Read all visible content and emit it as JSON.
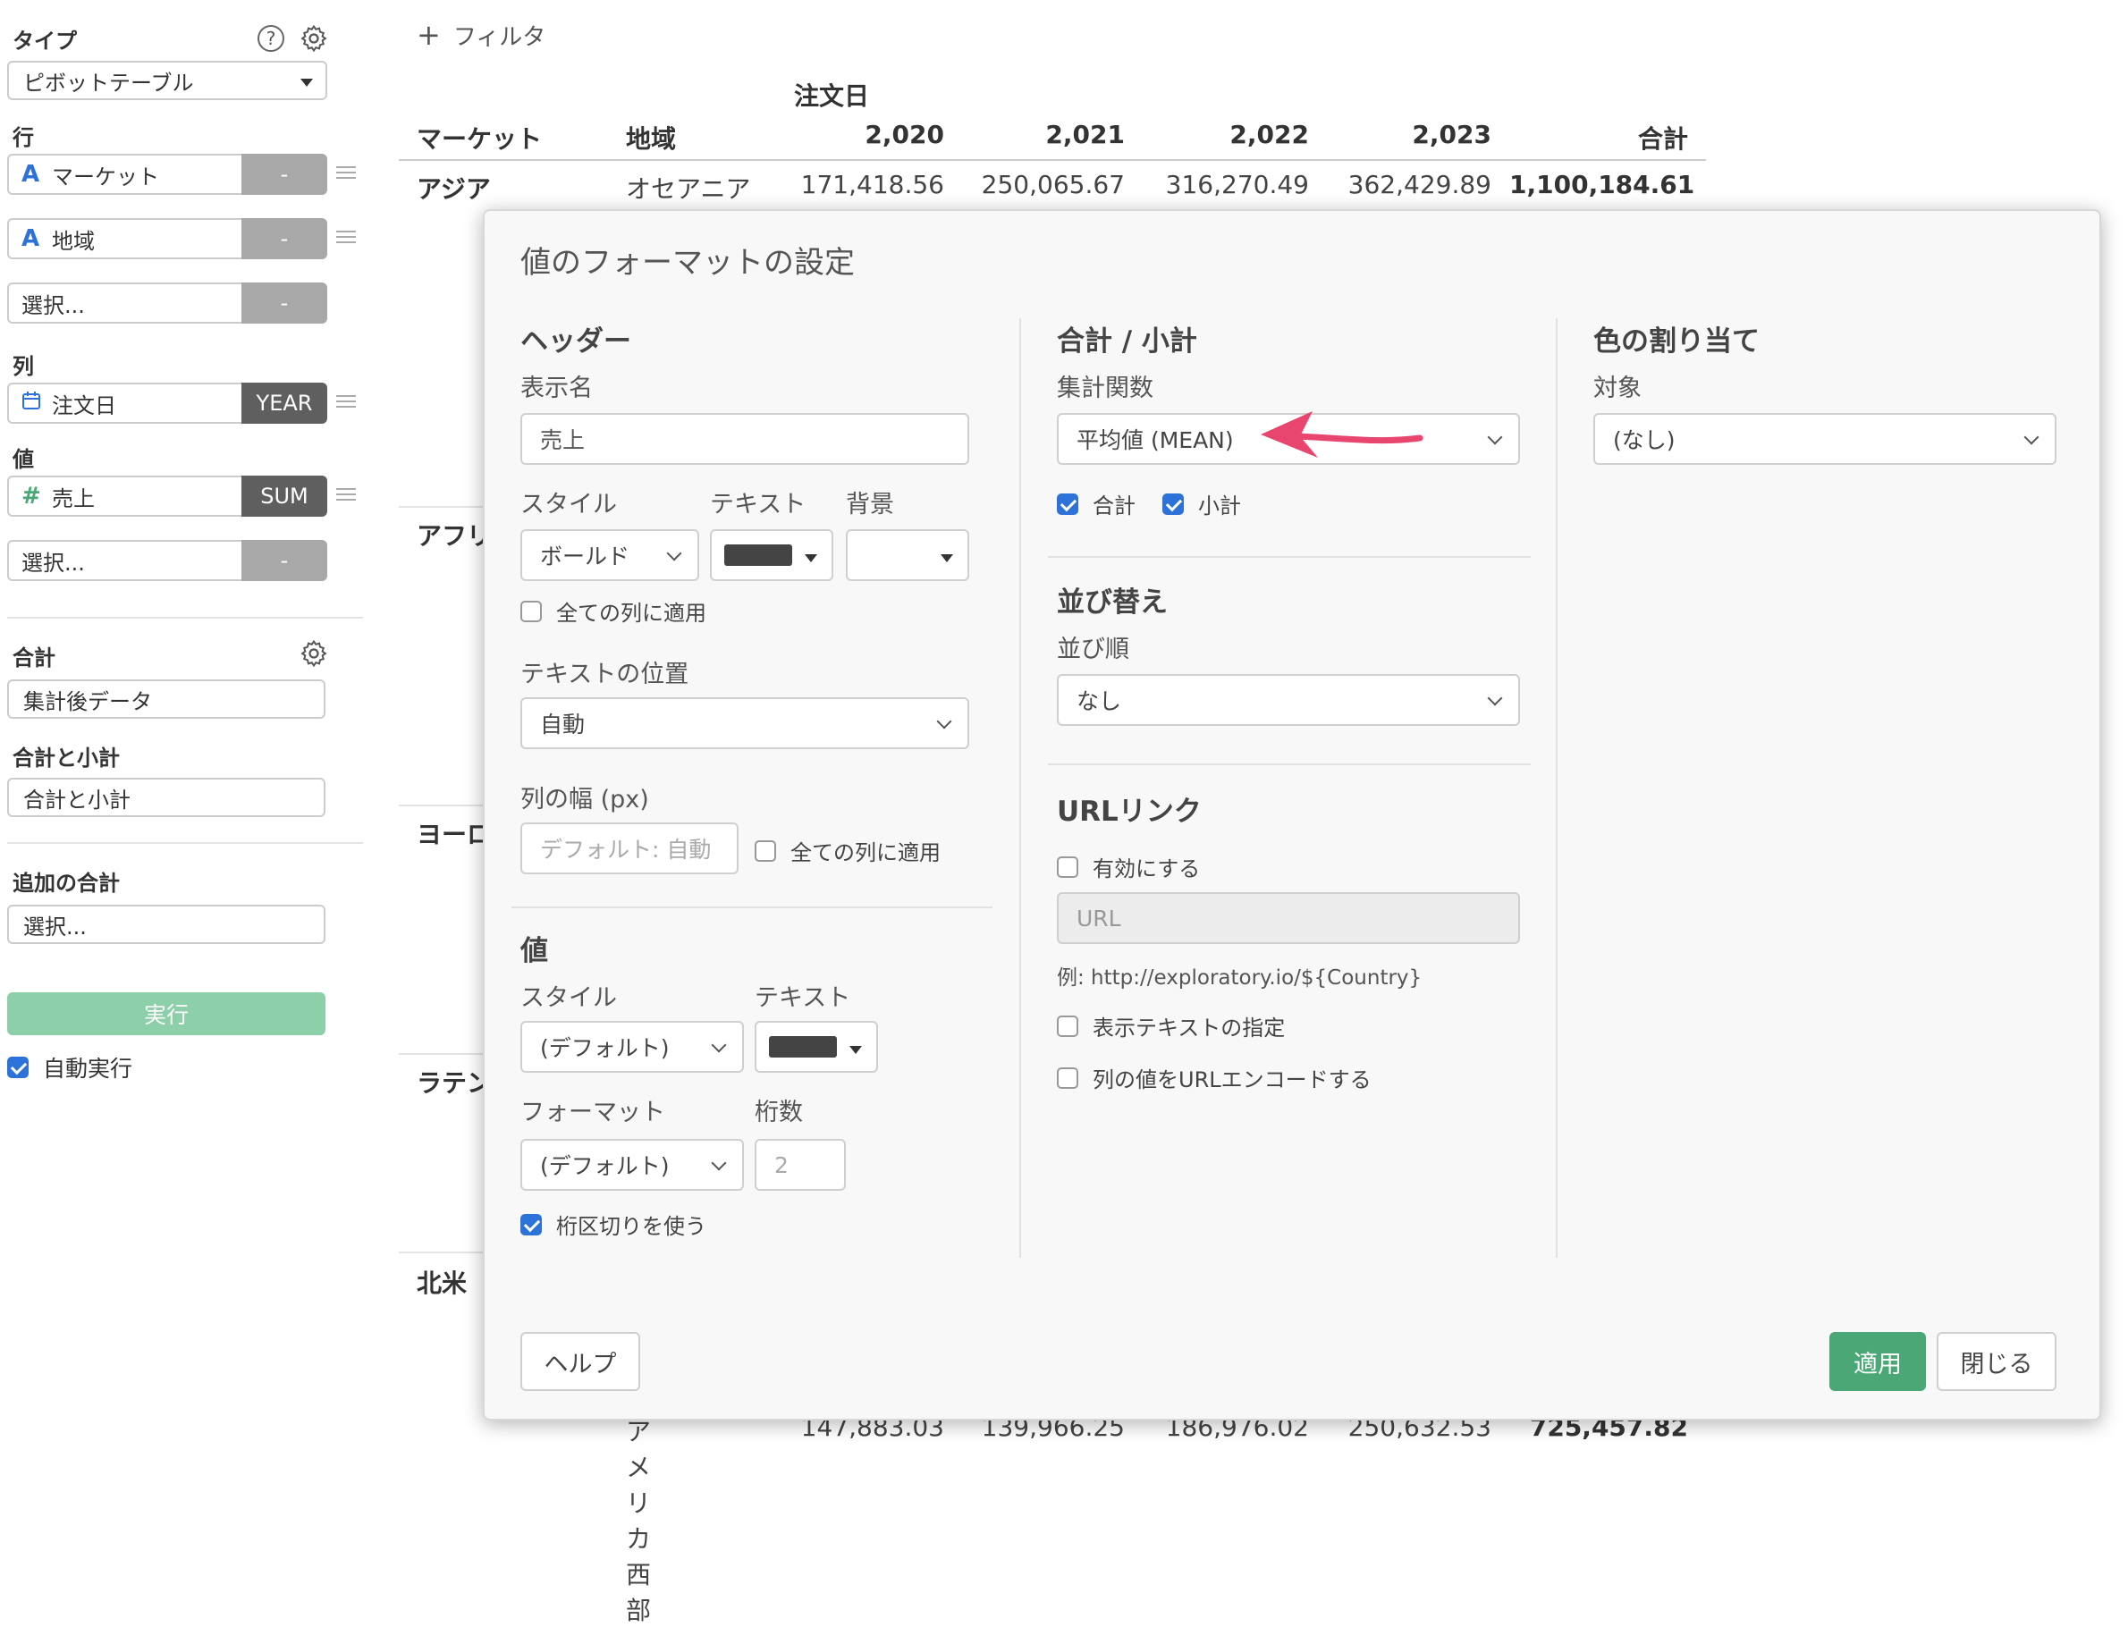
{
  "sidebar": {
    "type_label": "タイプ",
    "type_value": "ピボットテーブル",
    "rows_label": "行",
    "rows": [
      {
        "icon": "A",
        "label": "マーケット",
        "tag": "-"
      },
      {
        "icon": "A",
        "label": "地域",
        "tag": "-"
      },
      {
        "icon": "",
        "label": "選択...",
        "tag": "-"
      }
    ],
    "columns_label": "列",
    "columns": [
      {
        "icon": "calendar",
        "label": "注文日",
        "tag": "YEAR"
      }
    ],
    "values_label": "値",
    "values": [
      {
        "icon": "#",
        "label": "売上",
        "tag": "SUM"
      },
      {
        "icon": "",
        "label": "選択...",
        "tag": "-"
      }
    ],
    "total_label": "合計",
    "total_value": "集計後データ",
    "total_subtotal_label": "合計と小計",
    "total_subtotal_value": "合計と小計",
    "additional_total_label": "追加の合計",
    "additional_total_value": "選択...",
    "run_button": "実行",
    "auto_run_label": "自動実行",
    "auto_run_checked": true
  },
  "toolbar": {
    "filter_plus": "+",
    "filter_label": "フィルタ"
  },
  "table": {
    "column_group_header": "注文日",
    "headers": [
      "マーケット",
      "地域",
      "2,020",
      "2,021",
      "2,022",
      "2,023",
      "合計"
    ],
    "row_asia": [
      "アジア",
      "オセアニア",
      "171,418.56",
      "250,065.67",
      "316,270.49",
      "362,429.89",
      "1,100,184.61"
    ],
    "row_bottom": [
      "アメリカ西部",
      "147,883.03",
      "139,966.25",
      "186,976.02",
      "250,632.53",
      "725,457.82"
    ],
    "partial_markets": [
      "アフリ",
      "ヨーロ",
      "ラテン",
      "北米"
    ]
  },
  "dialog": {
    "title": "値のフォーマットの設定",
    "header_section": {
      "title": "ヘッダー",
      "display_name_label": "表示名",
      "display_name_value": "売上",
      "style_label": "スタイル",
      "style_value": "ボールド",
      "text_label": "テキスト",
      "background_label": "背景",
      "apply_all_label": "全ての列に適用",
      "text_position_label": "テキストの位置",
      "text_position_value": "自動",
      "column_width_label": "列の幅 (px)",
      "column_width_placeholder": "デフォルト: 自動",
      "column_width_apply_all": "全ての列に適用"
    },
    "value_section": {
      "title": "値",
      "style_label": "スタイル",
      "style_value": "(デフォルト)",
      "text_label": "テキスト",
      "format_label": "フォーマット",
      "format_value": "(デフォルト)",
      "digits_label": "桁数",
      "digits_placeholder": "2",
      "separator_label": "桁区切りを使う",
      "separator_checked": true
    },
    "total_section": {
      "title": "合計 / 小計",
      "agg_label": "集計関数",
      "agg_value": "平均値 (MEAN)",
      "total_check": "合計",
      "subtotal_check": "小計",
      "total_checked": true,
      "subtotal_checked": true
    },
    "sort_section": {
      "title": "並び替え",
      "order_label": "並び順",
      "order_value": "なし"
    },
    "url_section": {
      "title": "URLリンク",
      "enable_label": "有効にする",
      "url_placeholder": "URL",
      "example": "例: http://exploratory.io/${Country}",
      "display_text_label": "表示テキストの指定",
      "encode_label": "列の値をURLエンコードする"
    },
    "color_section": {
      "title": "色の割り当て",
      "target_label": "対象",
      "target_value": "(なし)"
    },
    "help_button": "ヘルプ",
    "apply_button": "適用",
    "close_button": "閉じる"
  },
  "colors": {
    "accent": "#2d72d9",
    "primary_button": "#4ba876",
    "run_button": "#8ccfa8",
    "arrow": "#e8466e",
    "tag_dark": "#5f5f5f",
    "tag_gray": "#a8a8a8"
  }
}
